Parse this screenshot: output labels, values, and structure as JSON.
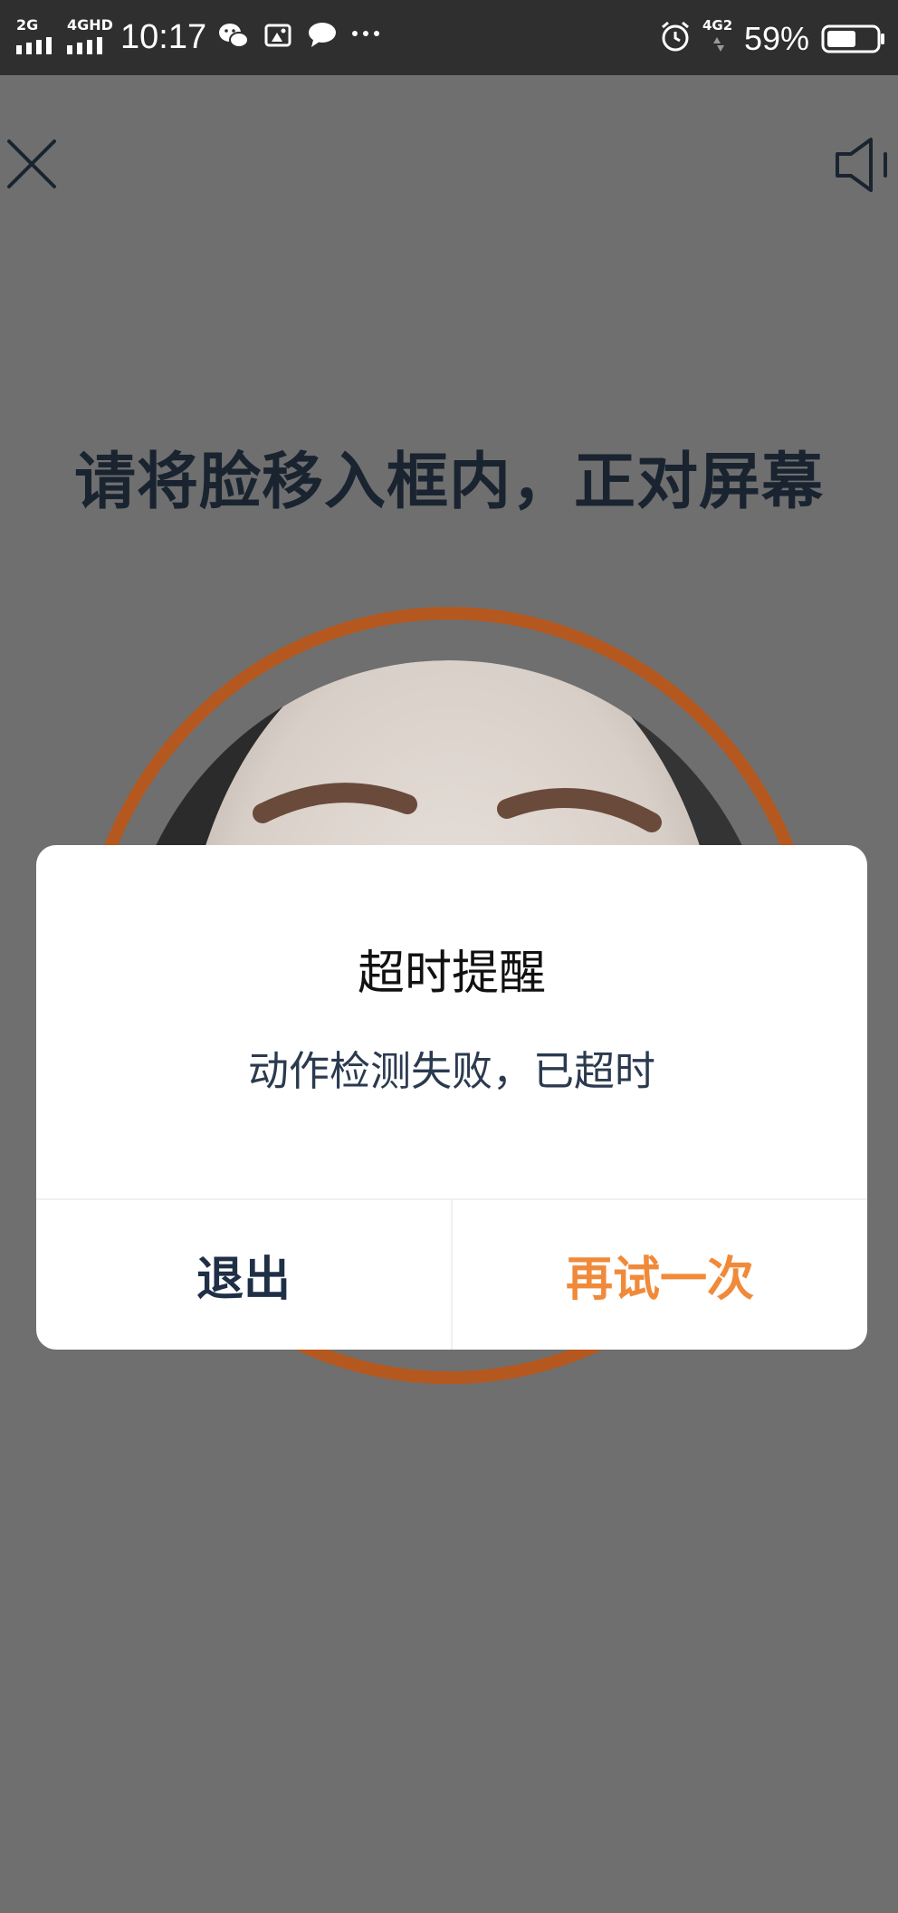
{
  "status_bar": {
    "signal_1_label": "2G",
    "signal_2_label": "4GHD",
    "time": "10:17",
    "network_label": "4G2",
    "battery_percent": "59%",
    "battery_level": 0.59,
    "icons": [
      "signal-icon",
      "wechat-icon",
      "gallery-icon",
      "message-icon",
      "more-dots-icon",
      "alarm-icon",
      "network-icon",
      "battery-icon"
    ]
  },
  "toolbar": {
    "close_icon": "close-icon",
    "sound_icon": "speaker-icon"
  },
  "instruction": "请将脸移入框内，正对屏幕",
  "colors": {
    "ring": "#b5581f",
    "accent": "#f08a3a",
    "overlay": "#6f6f6f"
  },
  "dialog": {
    "title": "超时提醒",
    "message": "动作检测失败，已超时",
    "exit_label": "退出",
    "retry_label": "再试一次"
  }
}
